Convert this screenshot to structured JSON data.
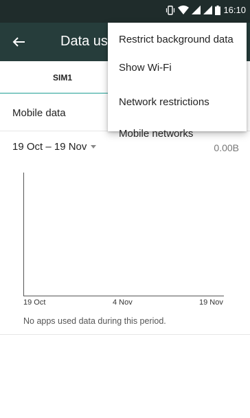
{
  "status_bar": {
    "time": "16:10",
    "icons": [
      "vibrate-icon",
      "wifi-icon",
      "signal-icon",
      "signal-icon",
      "battery-icon"
    ]
  },
  "app_bar": {
    "title": "Data usa",
    "back_icon": "arrow-left-icon"
  },
  "tabs": [
    {
      "label": "SIM1",
      "selected": true
    },
    {
      "label": "",
      "selected": false
    }
  ],
  "mobile_data": {
    "label": "Mobile data"
  },
  "billing_cycle": {
    "label": "19 Oct – 19 Nov",
    "usage": "0.00B"
  },
  "chart_data": {
    "type": "line",
    "categories": [
      "19 Oct",
      "4 Nov",
      "19 Nov"
    ],
    "series": [],
    "title": "",
    "xlabel": "",
    "ylabel": "",
    "grid": false
  },
  "no_data_message": "No apps used data during this period.",
  "overflow_menu": {
    "items": [
      "Restrict background data",
      "Show Wi-Fi",
      "Network restrictions",
      "Mobile networks"
    ]
  },
  "colors": {
    "status_bar": "#1f2c2b",
    "app_bar": "#263d3b",
    "accent": "#1e9e94"
  }
}
